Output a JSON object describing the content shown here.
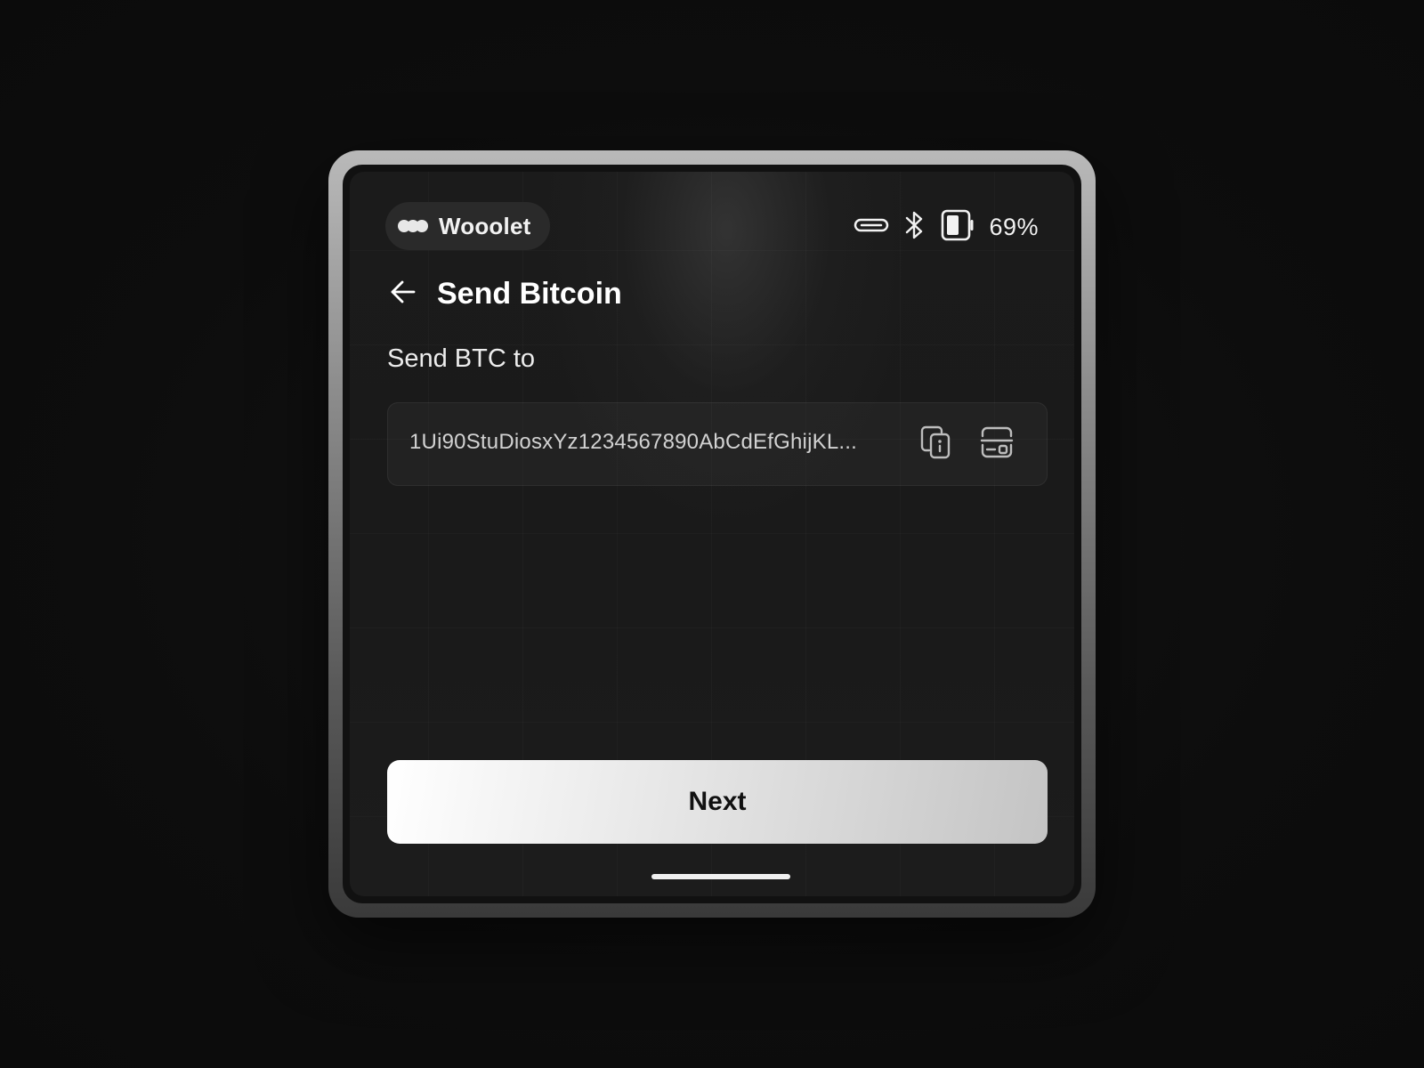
{
  "status_bar": {
    "app_name": "Wooolet",
    "battery_percent": "69%",
    "icons": [
      "usb-cable-icon",
      "bluetooth-icon",
      "battery-icon"
    ]
  },
  "header": {
    "title": "Send Bitcoin",
    "back_icon": "arrow-left-icon"
  },
  "form": {
    "label": "Send BTC to",
    "address_value": "1Ui90StuDiosxYz1234567890AbCdEfGhijKL...",
    "paste_icon": "paste-clipboard-icon",
    "scan_icon": "scan-qr-icon"
  },
  "actions": {
    "next_label": "Next"
  },
  "colors": {
    "background": "#0d0d0d",
    "screen": "#1b1b1b",
    "text": "#ffffff",
    "button_gradient_start": "#ffffff",
    "button_gradient_end": "#c4c4c4"
  }
}
